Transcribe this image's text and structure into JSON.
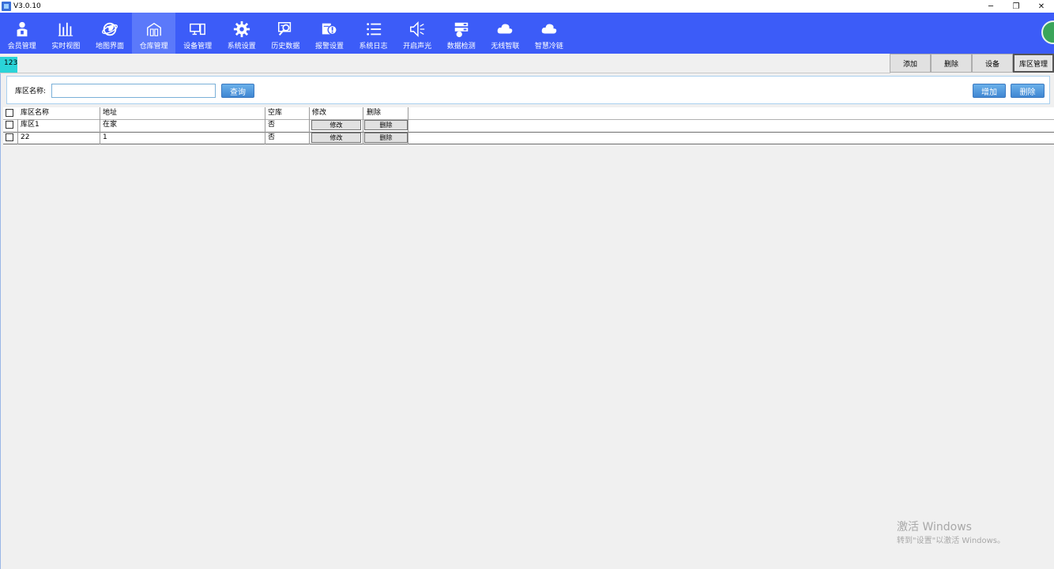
{
  "window": {
    "title": "V3.0.10",
    "controls": [
      "─",
      "❐",
      "✕"
    ]
  },
  "toolbar": {
    "items": [
      {
        "label": "会员管理",
        "icon": "member-icon"
      },
      {
        "label": "实时视图",
        "icon": "realtime-chart-icon"
      },
      {
        "label": "地图界面",
        "icon": "map-globe-icon"
      },
      {
        "label": "仓库管理",
        "icon": "warehouse-icon"
      },
      {
        "label": "设备管理",
        "icon": "device-icon"
      },
      {
        "label": "系统设置",
        "icon": "gear-icon"
      },
      {
        "label": "历史数据",
        "icon": "history-search-icon"
      },
      {
        "label": "报警设置",
        "icon": "alarm-icon"
      },
      {
        "label": "系统日志",
        "icon": "list-log-icon"
      },
      {
        "label": "开启声光",
        "icon": "speaker-icon"
      },
      {
        "label": "数据检测",
        "icon": "data-check-icon"
      },
      {
        "label": "无线智联",
        "icon": "cloud-icon"
      },
      {
        "label": "智慧冷链",
        "icon": "cloud-icon"
      }
    ],
    "active_index": 3,
    "bg_color": "#3c5cf8"
  },
  "tabstrip": {
    "tab_label": "123",
    "right_tabs": [
      "添加",
      "删除",
      "设备",
      "库区管理"
    ],
    "selected_right_tab": 3
  },
  "search": {
    "label": "库区名称:",
    "value": "",
    "query_button": "查询",
    "add_button": "增加",
    "delete_button": "删除"
  },
  "table": {
    "columns": [
      "库区名称",
      "地址",
      "空库",
      "修改",
      "删除"
    ],
    "rows": [
      {
        "name": "库区1",
        "address": "在家",
        "empty": "否",
        "edit": "修改",
        "delete": "删除"
      },
      {
        "name": "22",
        "address": "1",
        "empty": "否",
        "edit": "修改",
        "delete": "删除"
      }
    ]
  },
  "watermark": {
    "line1": "激活 Windows",
    "line2": "转到\"设置\"以激活 Windows。"
  }
}
